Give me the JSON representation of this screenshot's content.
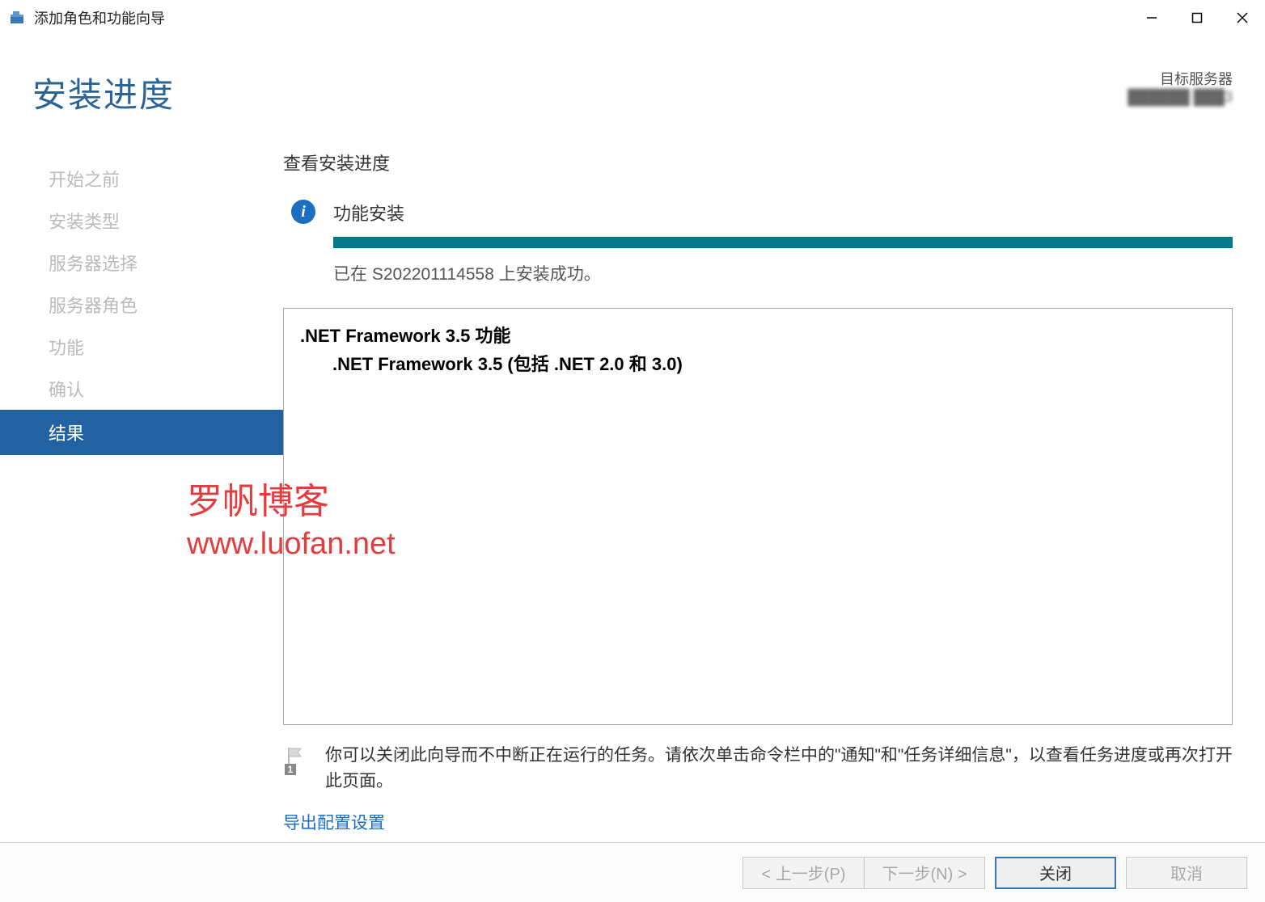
{
  "window": {
    "title": "添加角色和功能向导"
  },
  "header": {
    "title": "安装进度",
    "target_label": "目标服务器",
    "target_server": "██████ ███3"
  },
  "sidebar": {
    "items": [
      {
        "label": "开始之前"
      },
      {
        "label": "安装类型"
      },
      {
        "label": "服务器选择"
      },
      {
        "label": "服务器角色"
      },
      {
        "label": "功能"
      },
      {
        "label": "确认"
      },
      {
        "label": "结果",
        "active": true
      }
    ]
  },
  "main": {
    "section_title": "查看安装进度",
    "status_label": "功能安装",
    "status_message": "已在 S202201114558 上安装成功。",
    "details": {
      "line1": ".NET Framework 3.5 功能",
      "line2": ".NET Framework 3.5 (包括 .NET 2.0 和 3.0)"
    },
    "hint": "你可以关闭此向导而不中断正在运行的任务。请依次单击命令栏中的\"通知\"和\"任务详细信息\"，以查看任务进度或再次打开此页面。",
    "export_link": "导出配置设置"
  },
  "footer": {
    "prev": "< 上一步(P)",
    "next": "下一步(N) >",
    "close": "关闭",
    "cancel": "取消"
  },
  "watermark": {
    "line1": "罗帆博客",
    "line2": "www.luofan.net"
  }
}
